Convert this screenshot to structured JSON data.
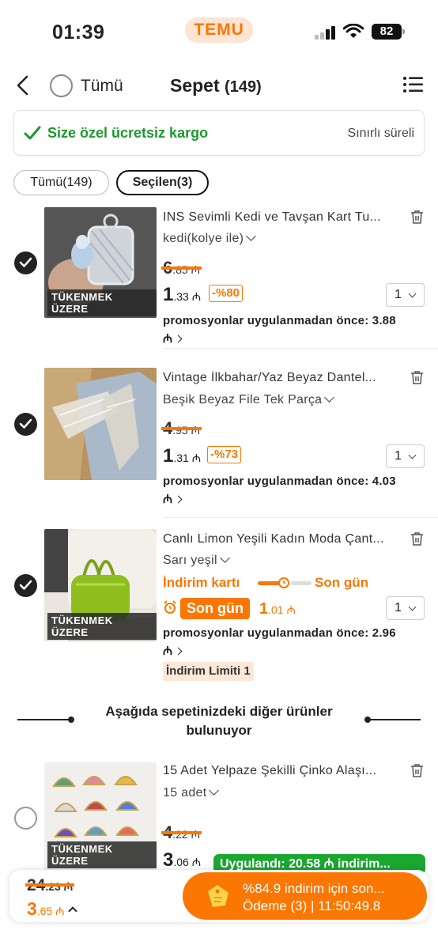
{
  "status_bar": {
    "time": "01:39",
    "app": "TEMU",
    "battery": "82"
  },
  "header": {
    "select_all_label": "Tümü",
    "title": "Sepet",
    "count": "(149)"
  },
  "banner": {
    "shipping_text": "Size özel ücretsiz kargo",
    "limited_text": "Sınırlı süreli"
  },
  "filters": {
    "all": "Tümü(149)",
    "selected": "Seçilen(3)"
  },
  "currency": "₼",
  "items": [
    {
      "selected": true,
      "title": "INS Sevimli Kedi ve Tavşan Kart Tu...",
      "variant": "kedi(kolye ile)",
      "old_price_int": "6",
      "old_price_dec": ".85",
      "price_int": "1",
      "price_dec": ".33",
      "discount": "-%80",
      "qty": "1",
      "promo": "promosyonlar uygulanmadan önce: 3.88",
      "tag": "TÜKENMEK ÜZERE"
    },
    {
      "selected": true,
      "title": "Vintage İlkbahar/Yaz Beyaz Dantel...",
      "variant": "Beşik Beyaz File Tek Parça",
      "old_price_int": "4",
      "old_price_dec": ".95",
      "price_int": "1",
      "price_dec": ".31",
      "discount": "-%73",
      "qty": "1",
      "promo": "promosyonlar uygulanmadan önce: 4.03",
      "tag": ""
    },
    {
      "selected": true,
      "title": "Canlı Limon Yeşili Kadın Moda Çant...",
      "variant": "Sarı yeşil",
      "discount_card_label": "İndirim kartı",
      "last_day_label": "Son gün",
      "last_day_badge": "Son gün",
      "price_int": "1",
      "price_dec": ".01",
      "qty": "1",
      "promo": "promosyonlar uygulanmadan önce: 2.96",
      "limit": "İndirim Limiti 1",
      "tag": "TÜKENMEK ÜZERE"
    },
    {
      "selected": false,
      "title": "15 Adet Yelpaze Şekilli Çinko Alaşı...",
      "variant": "15 adet",
      "old_price_int": "4",
      "old_price_dec": ".22",
      "price_int": "3",
      "price_dec": ".06",
      "tag": "TÜKENMEK ÜZERE"
    }
  ],
  "other_items_text": "Aşağıda sepetinizdeki diğer ürünler bulunuyor",
  "bottom_bar": {
    "total_old_int": "24",
    "total_old_dec": ".23",
    "total_new_int": "3",
    "total_new_dec": ".65",
    "applied": "Uygulandı: 20.58 ₼ indirim...",
    "checkout_line1": "%84.9 indirim için son...",
    "checkout_line2": "Ödeme (3) | 11:50:49.8"
  },
  "colors": {
    "accent": "#fb7701",
    "success": "#1a9a2c",
    "badge_green": "#1aa730"
  }
}
